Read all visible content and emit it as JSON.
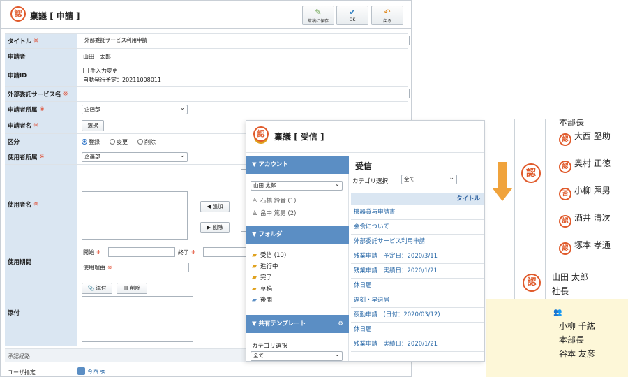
{
  "form": {
    "app_title": "稟議",
    "app_mode": "申請",
    "toolbar": {
      "save_label": "草稿に保存",
      "ok_label": "OK",
      "back_label": "戻る"
    },
    "required_mark": "※",
    "title_label": "タイトル",
    "title_value": "外部委託サービス利用申請",
    "applicant_label": "申請者",
    "applicant_value": "山田　太郎",
    "id_label": "申請ID",
    "id_manual_label": "手入力変更",
    "id_auto_label": "自動発行予定：20211008011",
    "service_label": "外部委託サービス名",
    "service_value": "",
    "affiliation_label": "申請者所属",
    "affiliation_value": "企画部",
    "applicant_name_label": "申請者名",
    "select_button": "選択",
    "division_label": "区分",
    "division_options": [
      "登録",
      "変更",
      "削除"
    ],
    "user_affiliation_label": "使用者所属",
    "user_affiliation_value": "企画部",
    "user_name_label": "使用者名",
    "add_button": "追加",
    "remove_button": "削除",
    "period_label": "使用期間",
    "start_label": "開始",
    "end_label": "終了",
    "reason_label": "使用理由",
    "attach_label": "添付",
    "attach_button": "添付",
    "attach_delete_button": "削除",
    "route_section_label": "承認経路",
    "user_spec_label": "ユーザ指定",
    "route_user": "今西 秀"
  },
  "inbox": {
    "app_title": "稟議",
    "app_mode": "受信",
    "account_header": "アカウント",
    "account_selected": "山田 太郎",
    "proxy_users": [
      "石橋 鈴音 (1)",
      "畠中 篤男 (2)"
    ],
    "folder_header": "フォルダ",
    "folders": [
      "受信 (10)",
      "進行中",
      "完了",
      "草稿",
      "後閲"
    ],
    "template_header": "共有テンプレート",
    "template_category_label": "カテゴリ選択",
    "template_category_value": "全て",
    "main_title": "受信",
    "category_label": "カテゴリ選択",
    "category_value": "全て",
    "column_title": "タイトル",
    "rows": [
      "機器貸与申請書",
      "会食について",
      "外部委託サービス利用申請",
      "残業申請　予定日：2020/3/11",
      "残業申請　実績日：2020/1/21",
      "休日届",
      "遅刻・早退届",
      "夜勤申請　(日付：2020/03/12)",
      "休日届",
      "残業申請　実績日：2020/1/21"
    ]
  },
  "route": {
    "top_partial": "本部長",
    "approvers": [
      "大西 堅助",
      "奥村 正徳",
      "小柳 照男",
      "酒井 清次",
      "塚本 孝通"
    ],
    "current_name": "山田 太郎",
    "current_title": "社長",
    "next_name": "小柳 千紘",
    "next_title": "本部長",
    "next_partial": "谷本 友彦"
  }
}
